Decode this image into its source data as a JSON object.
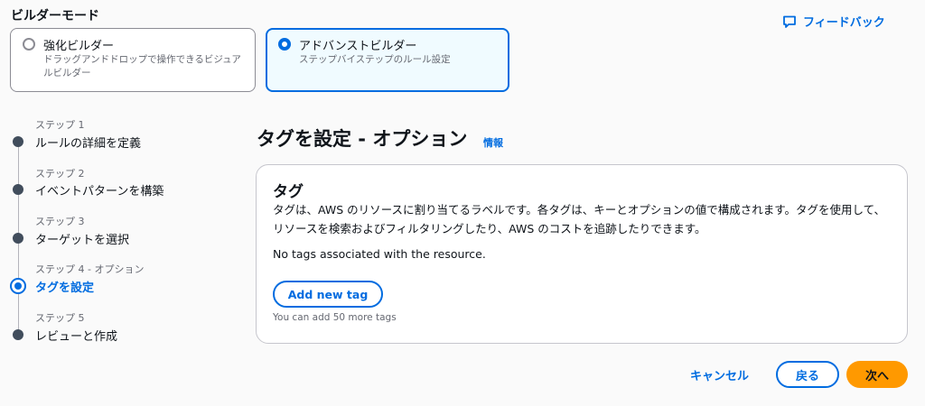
{
  "builder_mode": {
    "title": "ビルダーモード",
    "options": [
      {
        "label": "強化ビルダー",
        "description": "ドラッグアンドドロップで操作できるビジュアルビルダー",
        "selected": false
      },
      {
        "label": "アドバンストビルダー",
        "description": "ステップバイステップのルール設定",
        "selected": true
      }
    ]
  },
  "feedback": {
    "label": "フィードバック",
    "icon": "chat-bubble-icon"
  },
  "steps": [
    {
      "number": "ステップ 1",
      "label": "ルールの詳細を定義",
      "active": false
    },
    {
      "number": "ステップ 2",
      "label": "イベントパターンを構築",
      "active": false
    },
    {
      "number": "ステップ 3",
      "label": "ターゲットを選択",
      "active": false
    },
    {
      "number": "ステップ 4 - オプション",
      "label": "タグを設定",
      "active": true
    },
    {
      "number": "ステップ 5",
      "label": "レビューと作成",
      "active": false
    }
  ],
  "page": {
    "title": "タグを設定 - オプション",
    "info_link": "情報"
  },
  "tags": {
    "title": "タグ",
    "description": "タグは、AWS のリソースに割り当てるラベルです。各タグは、キーとオプションの値で構成されます。タグを使用して、リソースを検索およびフィルタリングしたり、AWS のコストを追跡したりできます。",
    "empty_message": "No tags associated with the resource.",
    "add_button": "Add new tag",
    "remaining_hint": "You can add 50 more tags"
  },
  "footer": {
    "cancel": "キャンセル",
    "back": "戻る",
    "next": "次へ"
  },
  "colors": {
    "accent": "#006ce0",
    "primary_button": "#ff9900",
    "selected_card_bg": "#f0fbff"
  }
}
